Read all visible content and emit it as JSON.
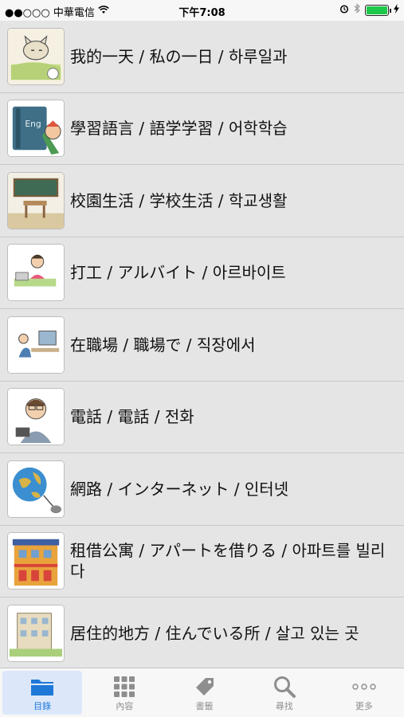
{
  "status_bar": {
    "carrier": "●●○○○ 中華電信",
    "time": "下午7:08"
  },
  "list": {
    "items": [
      {
        "label": "我的一天 / 私の一日 / 하루일과",
        "icon": "sleeping-cat-icon"
      },
      {
        "label": "學習語言 / 語学学習 / 어학학습",
        "icon": "english-book-icon"
      },
      {
        "label": "校園生活 / 学校生活 / 학교생활",
        "icon": "classroom-icon"
      },
      {
        "label": "打工 / アルバイト / 아르바이트",
        "icon": "cashier-icon"
      },
      {
        "label": "在職場 / 職場で / 직장에서",
        "icon": "office-worker-icon"
      },
      {
        "label": "電話 / 電話 / 전화",
        "icon": "phone-man-icon"
      },
      {
        "label": "網路 / インターネット / 인터넷",
        "icon": "globe-mouse-icon"
      },
      {
        "label": "租借公寓 / アパートを借りる / 아파트를 빌리다",
        "icon": "apartment-icon"
      },
      {
        "label": "居住的地方 / 住んでいる所 / 살고 있는 곳",
        "icon": "building-icon"
      }
    ]
  },
  "tabbar": {
    "tabs": [
      {
        "label": "目錄",
        "icon": "folder-icon",
        "active": true
      },
      {
        "label": "內容",
        "icon": "grid-icon",
        "active": false
      },
      {
        "label": "書籤",
        "icon": "tag-icon",
        "active": false
      },
      {
        "label": "尋找",
        "icon": "search-icon",
        "active": false
      },
      {
        "label": "更多",
        "icon": "more-icon",
        "active": false
      }
    ]
  },
  "colors": {
    "accent": "#1e78d8",
    "battery": "#1ec84a",
    "background": "#e5e5e5"
  }
}
